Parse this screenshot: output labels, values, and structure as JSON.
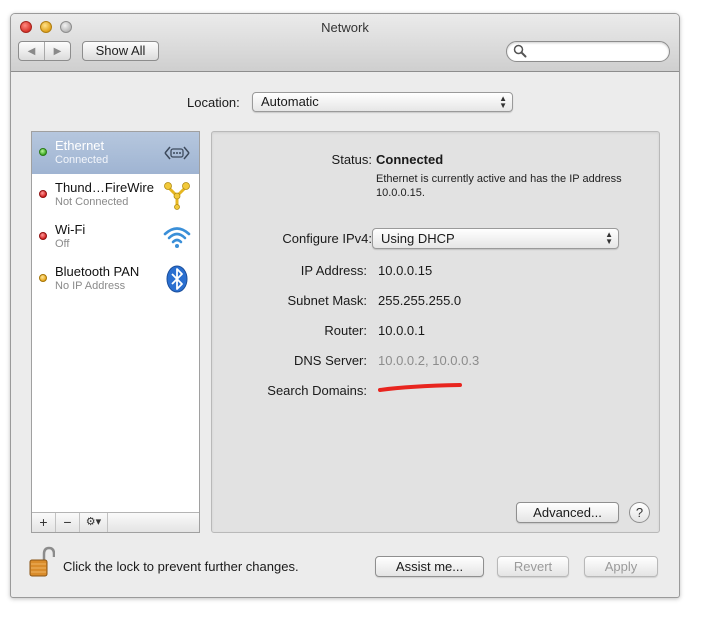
{
  "window": {
    "title": "Network"
  },
  "toolbar": {
    "back_icon": "chevron-left-icon",
    "forward_icon": "chevron-right-icon",
    "show_all_label": "Show All",
    "search_placeholder": "",
    "search_value": ""
  },
  "location": {
    "label": "Location:",
    "value": "Automatic"
  },
  "services": [
    {
      "name": "Ethernet",
      "status": "Connected",
      "status_color": "green",
      "icon": "ethernet-icon",
      "selected": true
    },
    {
      "name": "Thund…FireWire",
      "status": "Not Connected",
      "status_color": "red",
      "icon": "thunderbolt-firewire-icon",
      "selected": false
    },
    {
      "name": "Wi-Fi",
      "status": "Off",
      "status_color": "red",
      "icon": "wifi-icon",
      "selected": false
    },
    {
      "name": "Bluetooth PAN",
      "status": "No IP Address",
      "status_color": "yellow",
      "icon": "bluetooth-icon",
      "selected": false
    }
  ],
  "sidebar_controls": {
    "add": "+",
    "remove": "−",
    "gear": "gear-icon"
  },
  "detail": {
    "status_label": "Status:",
    "status_value": "Connected",
    "status_desc": "Ethernet is currently active and has the IP address 10.0.0.15.",
    "configure_label": "Configure IPv4:",
    "configure_value": "Using DHCP",
    "ip_label": "IP Address:",
    "ip_value": "10.0.0.15",
    "subnet_label": "Subnet Mask:",
    "subnet_value": "255.255.255.0",
    "router_label": "Router:",
    "router_value": "10.0.0.1",
    "dns_label": "DNS Server:",
    "dns_value": "10.0.0.2, 10.0.0.3",
    "search_domains_label": "Search Domains:",
    "advanced_label": "Advanced...",
    "help_label": "?"
  },
  "footer": {
    "lock_text": "Click the lock to prevent further changes.",
    "assist_label": "Assist me...",
    "revert_label": "Revert",
    "apply_label": "Apply"
  },
  "colors": {
    "selection": "#a9bcd8",
    "status_green": "#35a51d",
    "status_red": "#d01a1a",
    "status_yellow": "#e6a213",
    "redaction": "#e8251f"
  }
}
